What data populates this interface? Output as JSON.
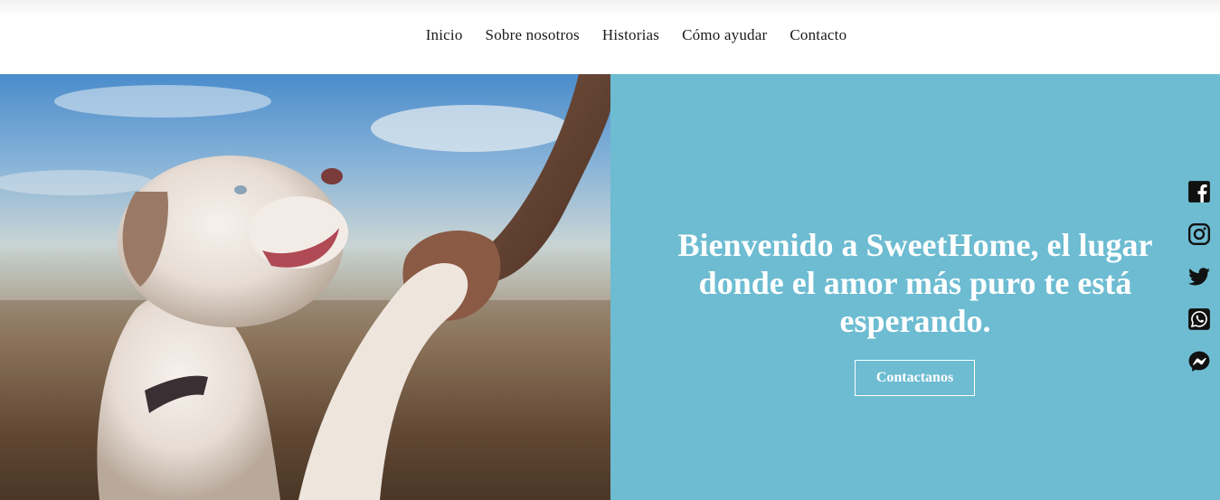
{
  "nav": {
    "items": [
      {
        "label": "Inicio"
      },
      {
        "label": "Sobre nosotros"
      },
      {
        "label": "Historias"
      },
      {
        "label": "Cómo ayudar"
      },
      {
        "label": "Contacto"
      }
    ]
  },
  "hero": {
    "image_alt": "dog-giving-paw",
    "title": "Bienvenido a SweetHome, el lugar donde el amor más puro te está esperando.",
    "cta_label": "Contactanos",
    "panel_color": "#6dbcd2"
  },
  "social": {
    "icons": [
      "facebook-icon",
      "instagram-icon",
      "twitter-icon",
      "whatsapp-icon",
      "messenger-icon"
    ]
  }
}
